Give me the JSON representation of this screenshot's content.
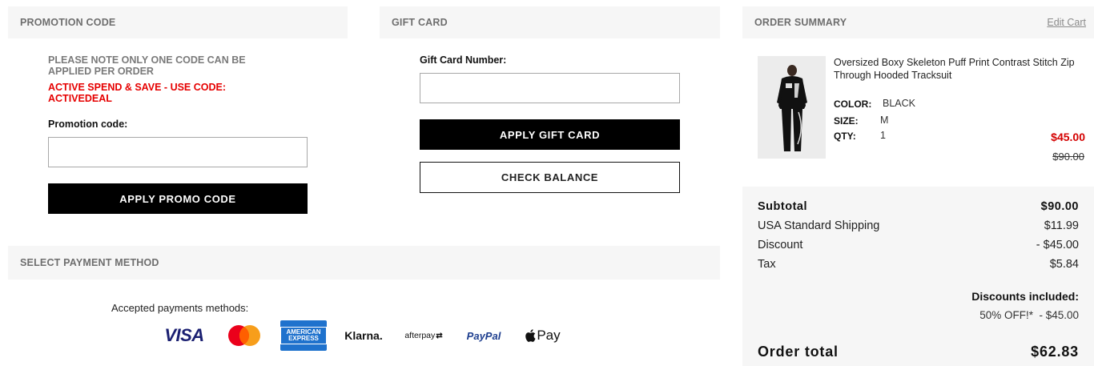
{
  "promotion": {
    "heading": "PROMOTION CODE",
    "note": "PLEASE NOTE ONLY ONE CODE CAN BE APPLIED PER ORDER",
    "active_deal": "ACTIVE SPEND & SAVE - USE CODE: ACTIVEDEAL",
    "field_label": "Promotion code:",
    "field_value": "",
    "button_label": "APPLY PROMO CODE"
  },
  "gift_card": {
    "heading": "GIFT CARD",
    "field_label": "Gift Card Number:",
    "field_value": "",
    "apply_label": "APPLY GIFT CARD",
    "balance_label": "CHECK BALANCE"
  },
  "payment": {
    "heading": "SELECT PAYMENT METHOD",
    "accepted_text": "Accepted payments methods:",
    "methods": [
      {
        "icon": "visa-logo",
        "label": "VISA"
      },
      {
        "icon": "mastercard-logo",
        "label": ""
      },
      {
        "icon": "amex-logo",
        "label": "AMERICAN EXPRESS"
      },
      {
        "icon": "klarna-logo",
        "label": "Klarna."
      },
      {
        "icon": "afterpay-logo",
        "label": "afterpay"
      },
      {
        "icon": "paypal-logo",
        "label": "PayPal"
      },
      {
        "icon": "applepay-logo",
        "label": "Pay"
      }
    ]
  },
  "summary": {
    "heading": "ORDER SUMMARY",
    "edit_link": "Edit Cart",
    "product": {
      "name": "Oversized Boxy Skeleton Puff Print Contrast Stitch Zip Through Hooded Tracksuit",
      "color_label": "COLOR:",
      "color_value": "BLACK",
      "size_label": "SIZE:",
      "size_value": "M",
      "qty_label": "QTY:",
      "qty_value": "1",
      "price": "$45.00",
      "original_price": "$90.00"
    },
    "totals": {
      "subtotal_label": "Subtotal",
      "subtotal_value": "$90.00",
      "shipping_label": "USA Standard Shipping",
      "shipping_value": "$11.99",
      "discount_label": "Discount",
      "discount_value": "- $45.00",
      "tax_label": "Tax",
      "tax_value": "$5.84",
      "discounts_included_label": "Discounts included:",
      "discount_line": "50% OFF!*  - $45.00",
      "order_total_label": "Order total",
      "order_total_value": "$62.83"
    }
  },
  "colors": {
    "accent_red": "#e60000",
    "price_red": "#d40000",
    "button_black": "#000000",
    "panel_grey": "#f6f6f6"
  }
}
